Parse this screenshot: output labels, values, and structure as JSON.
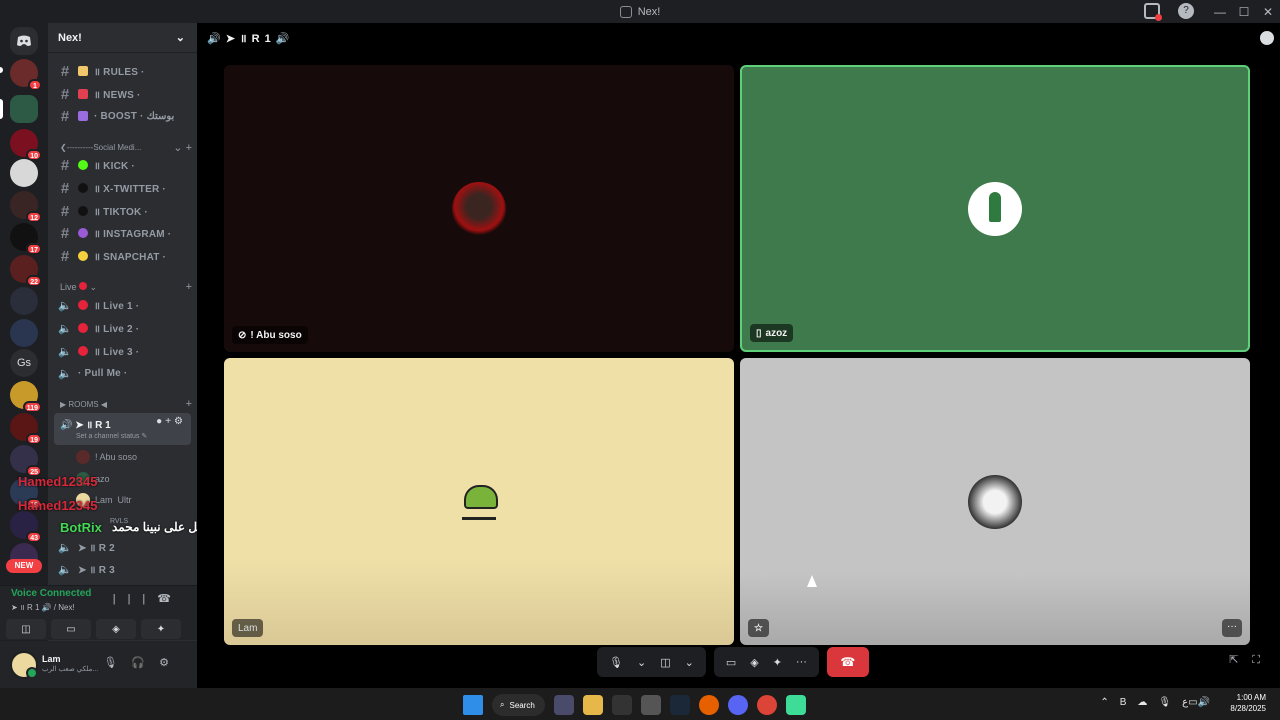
{
  "window": {
    "title": "Nex!",
    "controls": [
      "—",
      "☐",
      "✕"
    ]
  },
  "server": {
    "name": "Nex!"
  },
  "rail_servers": [
    {
      "badge": "1"
    },
    {
      "badge": ""
    },
    {
      "badge": "10"
    },
    {
      "badge": ""
    },
    {
      "badge": "12"
    },
    {
      "badge": "17"
    },
    {
      "badge": "22"
    },
    {
      "badge": ""
    },
    {
      "badge": ""
    },
    {
      "badge": ""
    },
    {
      "badge": "119"
    },
    {
      "badge": "19"
    },
    {
      "badge": "25"
    },
    {
      "badge": "19"
    },
    {
      "badge": "43"
    }
  ],
  "rail_gs": "Gs",
  "rail_new": "NEW",
  "channels_top": [
    {
      "label": "॥ RULES ·",
      "dot": "#f0c86b"
    },
    {
      "label": "॥ NEWS ·",
      "dot": "#e04050"
    },
    {
      "label": "· BOOST · بوستك",
      "dot": "#9a6ce0"
    }
  ],
  "category_social": "❮----------Social Medi...",
  "channels_social": [
    {
      "label": "॥ KICK ·",
      "dot": "#53fc18"
    },
    {
      "label": "॥ X-TWITTER ·",
      "dot": "#111111"
    },
    {
      "label": "॥ TIKTOK ·",
      "dot": "#111111"
    },
    {
      "label": "॥ INSTAGRAM ·",
      "dot": "#9a5bd6"
    },
    {
      "label": "॥ SNAPCHAT ·",
      "dot": "#f4d03f"
    }
  ],
  "category_live": "Live",
  "channels_live": [
    {
      "label": "॥ Live 1 ·",
      "dot": "#e5243b"
    },
    {
      "label": "॥ Live 2 ·",
      "dot": "#e5243b"
    },
    {
      "label": "॥ Live 3 ·",
      "dot": "#e5243b"
    },
    {
      "label": "· Pull Me ·",
      "dot": ""
    }
  ],
  "category_rooms": "▶ ROOMS ◀",
  "active_channel": {
    "label": "➤ ॥ R 1",
    "status": "Set a channel status ✎"
  },
  "voice_users": [
    {
      "name": "! Abu soso"
    },
    {
      "name": "azo"
    },
    {
      "name": "Lam"
    },
    {
      "name": "Ultr"
    },
    {
      "name": "RVLS"
    }
  ],
  "overlay_names": [
    "Hamed12345",
    "Hamed12345"
  ],
  "overlay_botrix": "BotRix",
  "overlay_arabic": "صل على نبينا محمد",
  "other_rooms": [
    "➤ ॥ R 2",
    "➤ ॥ R 3"
  ],
  "voice_panel": {
    "status": "Voice Connected",
    "channel": "➤ ॥ R 1 🔊 / Nex!"
  },
  "user": {
    "name": "Lam",
    "subtitle": "ملكي صعب الرب..."
  },
  "stage": {
    "header": "🔊 ➤ ॥ R 1 🔊"
  },
  "tiles": [
    {
      "name": "! Abu soso",
      "icon": "camera-off"
    },
    {
      "name": "azoz",
      "icon": "phone"
    },
    {
      "name": "Lam",
      "icon": ""
    },
    {
      "name": "",
      "icon": "star"
    }
  ],
  "taskbar": {
    "search": "Search",
    "time": "1:00 AM",
    "date": "8/28/2025"
  },
  "colors": {
    "connected": "#23a55a",
    "hangup": "#da373c",
    "speaking_border": "#5ed07a"
  }
}
